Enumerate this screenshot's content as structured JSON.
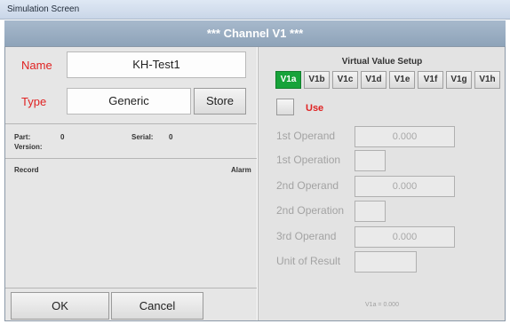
{
  "window": {
    "title": "Simulation Screen"
  },
  "header": {
    "title": "*** Channel V1 ***"
  },
  "left": {
    "name_label": "Name",
    "name_value": "KH-Test1",
    "type_label": "Type",
    "type_value": "Generic",
    "store_label": "Store",
    "part_label": "Part:",
    "part_value": "0",
    "serial_label": "Serial:",
    "serial_value": "0",
    "version_label": "Version:",
    "record_label": "Record",
    "alarm_label": "Alarm",
    "ok_label": "OK",
    "cancel_label": "Cancel"
  },
  "right": {
    "setup_title": "Virtual Value Setup",
    "tabs": [
      "V1a",
      "V1b",
      "V1c",
      "V1d",
      "V1e",
      "V1f",
      "V1g",
      "V1h"
    ],
    "active_tab": "V1a",
    "use_label": "Use",
    "use_checked": false,
    "first_operand_label": "1st Operand",
    "first_operand_value": "0.000",
    "first_operation_label": "1st Operation",
    "second_operand_label": "2nd Operand",
    "second_operand_value": "0.000",
    "second_operation_label": "2nd Operation",
    "third_operand_label": "3rd Operand",
    "third_operand_value": "0.000",
    "unit_label": "Unit of Result",
    "result_text": "V1a = 0.000"
  },
  "colors": {
    "label_red": "#e02222",
    "tab_active": "#17a33a",
    "header": "#8ea3b9"
  }
}
